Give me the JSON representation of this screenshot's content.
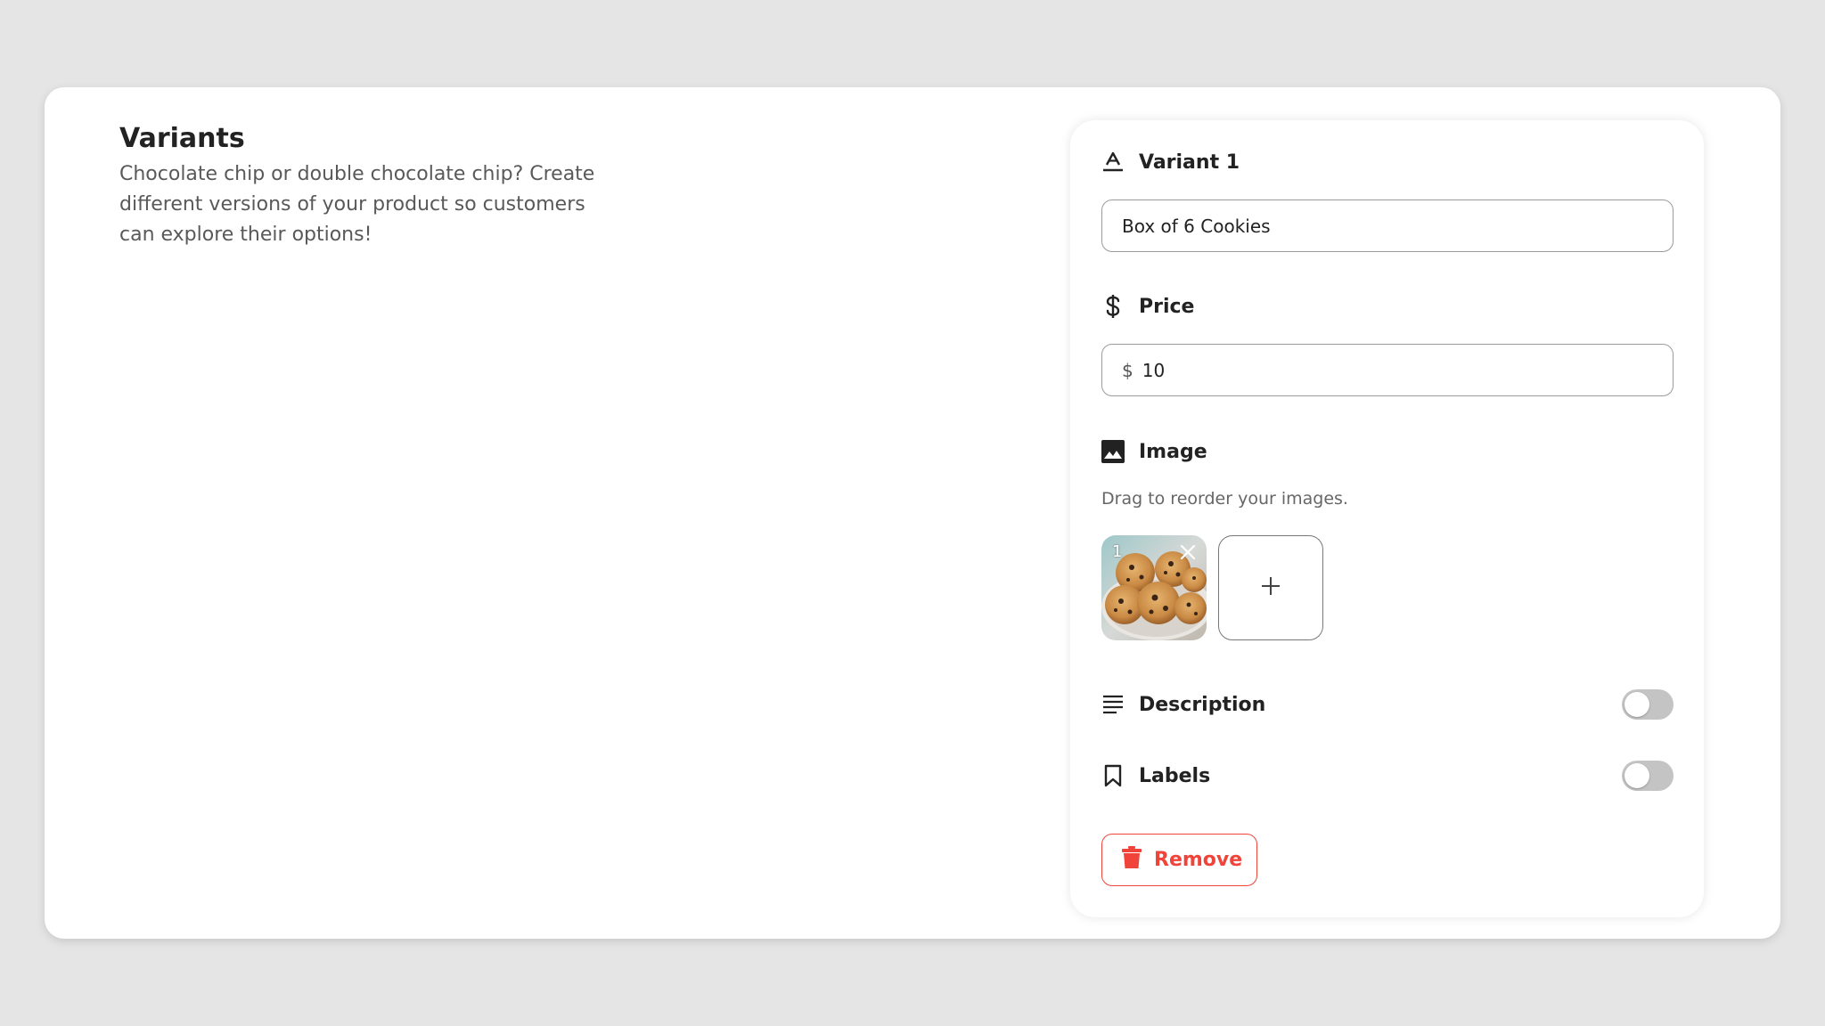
{
  "section": {
    "title": "Variants",
    "description": "Chocolate chip or double chocolate chip? Create different versions of your product so customers can explore their options!"
  },
  "variant": {
    "name_label": "Variant 1",
    "name_value": "Box of 6 Cookies",
    "price_label": "Price",
    "price_prefix": "$",
    "price_value": "10",
    "image_label": "Image",
    "image_hint": "Drag to reorder your images.",
    "images": [
      {
        "index": "1",
        "alt": "chocolate chip cookies on a plate"
      }
    ],
    "add_image_glyph": "+",
    "description_label": "Description",
    "description_enabled": false,
    "labels_label": "Labels",
    "labels_enabled": false,
    "remove_label": "Remove"
  },
  "colors": {
    "danger": "#f0443a",
    "toggle_off": "#c4c4c4"
  }
}
